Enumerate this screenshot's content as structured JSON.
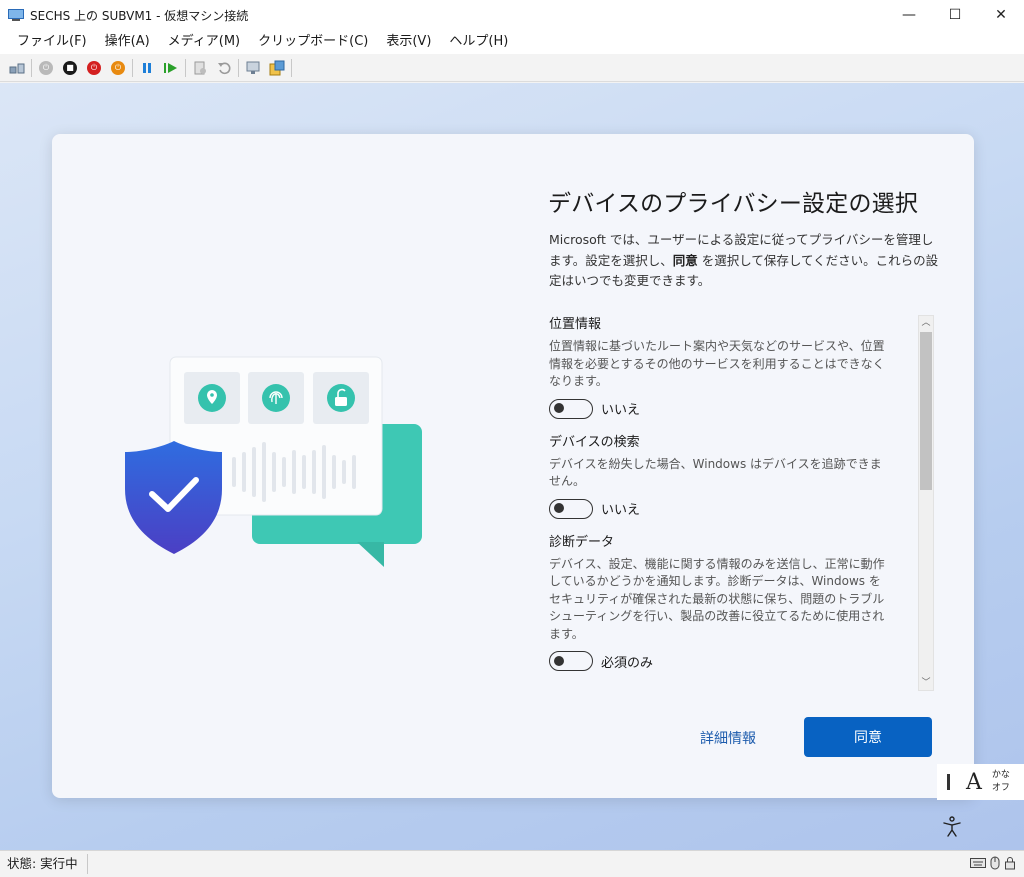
{
  "window": {
    "title": "SECHS 上の SUBVM1 - 仮想マシン接続",
    "controls": {
      "minimize": "—",
      "maximize": "☐",
      "close": "✕"
    }
  },
  "menu": [
    "ファイル(F)",
    "操作(A)",
    "メディア(M)",
    "クリップボード(C)",
    "表示(V)",
    "ヘルプ(H)"
  ],
  "toolbar": {
    "buttons": [
      "ctrl-alt-del-icon",
      "start-icon",
      "turn-off-icon",
      "shutdown-icon",
      "save-state-icon",
      "pause-icon",
      "resume-icon",
      "checkpoint-icon",
      "revert-icon",
      "enhanced-session-icon",
      "share-icon"
    ]
  },
  "privacy": {
    "heading": "デバイスのプライバシー設定の選択",
    "intro_before": "Microsoft では、ユーザーによる設定に従ってプライバシーを管理します。設定を選択し、",
    "intro_bold": "同意",
    "intro_after": " を選択して保存してください。これらの設定はいつでも変更できます。",
    "settings": [
      {
        "title": "位置情報",
        "desc": "位置情報に基づいたルート案内や天気などのサービスや、位置情報を必要とするその他のサービスを利用することはできなくなります。",
        "toggle": "いいえ"
      },
      {
        "title": "デバイスの検索",
        "desc": "デバイスを紛失した場合、Windows はデバイスを追跡できません。",
        "toggle": "いいえ"
      },
      {
        "title": "診断データ",
        "desc": "デバイス、設定、機能に関する情報のみを送信し、正常に動作しているかどうかを通知します。診断データは、Windows をセキュリティが確保された最新の状態に保ち、問題のトラブルシューティングを行い、製品の改善に役立てるために使用されます。",
        "toggle": "必須のみ"
      }
    ],
    "details_link": "詳細情報",
    "agree_button": "同意"
  },
  "ime": {
    "mode_letter": "A",
    "kana_line1": "かな",
    "kana_line2": "オフ"
  },
  "status": {
    "text": "状態: 実行中"
  },
  "colors": {
    "accent": "#0862c2",
    "link": "#1d5cad",
    "teal": "#3ec8b4",
    "shield": "#3b5bd8"
  }
}
